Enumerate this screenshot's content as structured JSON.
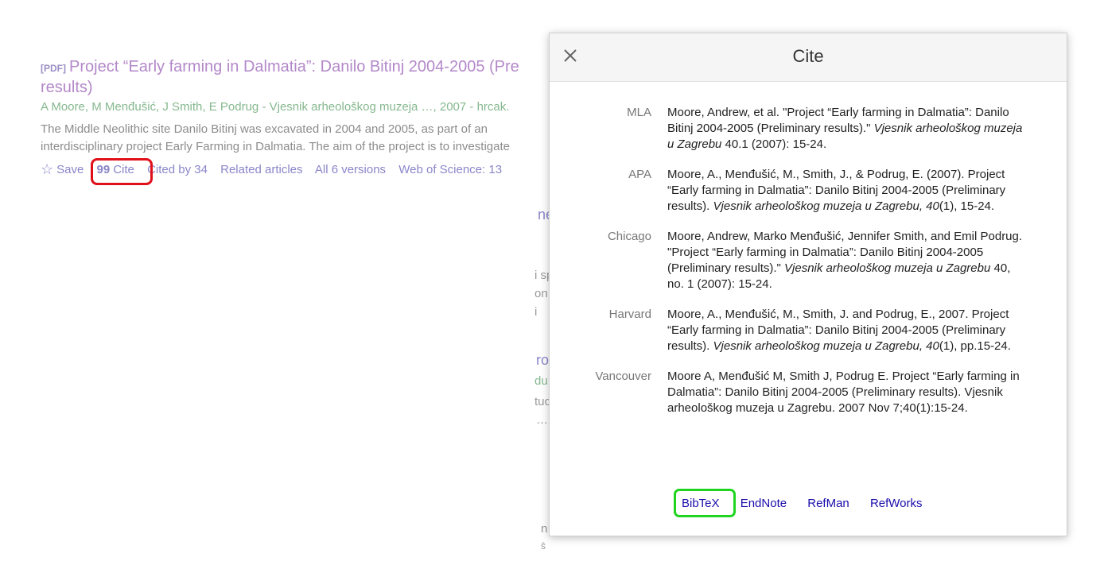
{
  "result": {
    "pdf_tag": "[PDF]",
    "title_line1": "Project “Early farming in Dalmatia”: Danilo Bitinj 2004-2005 (Pre",
    "title_line2": "results)",
    "authors": "A Moore, M Menđušić, J Smith, E Podrug - Vjesnik arheološkog muzeja …, 2007 - hrcak.",
    "snippet_line1": "The Middle Neolithic site Danilo Bitinj was excavated in 2004 and 2005, as part of an",
    "snippet_line2": "interdisciplinary project Early Farming in Dalmatia. The aim of the project is to investigate",
    "actions": {
      "save": "Save",
      "quote_glyph": "99",
      "cite": "Cite",
      "cited_by": "Cited by 34",
      "related": "Related articles",
      "versions": "All 6 versions",
      "wos": "Web of Science: 13"
    }
  },
  "background_fragments": [
    "ne",
    "i sp",
    "on",
    "i",
    "ro",
    "du",
    "tuc",
    "…",
    "n",
    "ŝ"
  ],
  "dialog": {
    "title": "Cite",
    "close_icon": "close-icon",
    "citations": [
      {
        "format": "MLA",
        "pre": "Moore, Andrew, et al. \"Project “Early farming in Dalmatia”: Danilo Bitinj 2004-2005 (Preliminary results).\" ",
        "journal": "Vjesnik arheološkog muzeja u Zagrebu",
        "post": " 40.1 (2007): 15-24."
      },
      {
        "format": "APA",
        "pre": "Moore, A., Menđušić, M., Smith, J., & Podrug, E. (2007). Project “Early farming in Dalmatia”: Danilo Bitinj 2004-2005 (Preliminary results). ",
        "journal": "Vjesnik arheološkog muzeja u Zagrebu, 40",
        "post": "(1), 15-24."
      },
      {
        "format": "Chicago",
        "pre": "Moore, Andrew, Marko Menđušić, Jennifer Smith, and Emil Podrug. \"Project “Early farming in Dalmatia”: Danilo Bitinj 2004-2005 (Preliminary results).\" ",
        "journal": "Vjesnik arheološkog muzeja u Zagrebu",
        "post": " 40, no. 1 (2007): 15-24."
      },
      {
        "format": "Harvard",
        "pre": "Moore, A., Menđušić, M., Smith, J. and Podrug, E., 2007. Project “Early farming in Dalmatia”: Danilo Bitinj 2004-2005 (Preliminary results). ",
        "journal": "Vjesnik arheološkog muzeja u Zagrebu, 40",
        "post": "(1), pp.15-24."
      },
      {
        "format": "Vancouver",
        "pre": "Moore A, Menđušić M, Smith J, Podrug E. Project “Early farming in Dalmatia”: Danilo Bitinj 2004-2005 (Preliminary results). Vjesnik arheološkog muzeja u Zagrebu. 2007 Nov 7;40(1):15-24.",
        "journal": "",
        "post": ""
      }
    ],
    "export_links": [
      "BibTeX",
      "EndNote",
      "RefMan",
      "RefWorks"
    ]
  },
  "colors": {
    "title_link": "#b388c9",
    "authors": "#86b88f",
    "action_link": "#8a86c9",
    "export_link": "#1a0dab",
    "highlight_red": "#e0101a",
    "highlight_green": "#1fd51f"
  }
}
